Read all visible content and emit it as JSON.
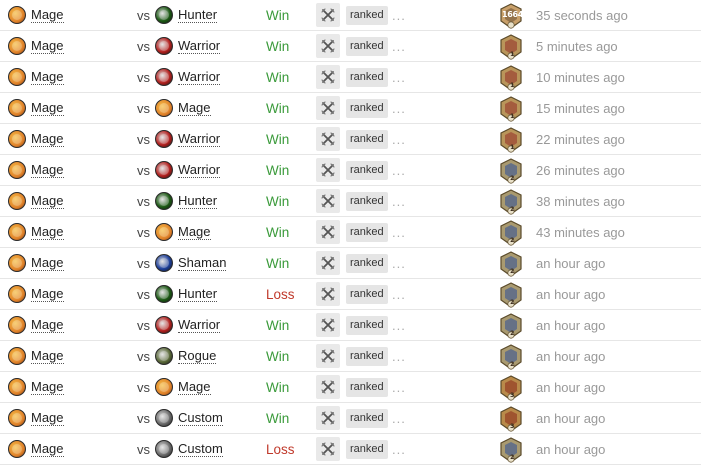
{
  "colors": {
    "win": "#3a9a3a",
    "loss": "#c0392b",
    "mage": "#e0822a",
    "hunter": "#1c5a14",
    "warrior": "#b3201e",
    "shaman": "#1d3f9a",
    "rogue": "#5b6a3a",
    "custom": "#6d6d6d"
  },
  "games": [
    {
      "hero": "Mage",
      "hero_icon": "mage-icon",
      "vs": "vs",
      "opponent": "Hunter",
      "opponent_icon": "hunter-icon",
      "result": "Win",
      "mode": "ranked",
      "dots": "...",
      "rank_icon": "legend-rank-icon",
      "rank": "1664",
      "time": "35 seconds ago"
    },
    {
      "hero": "Mage",
      "hero_icon": "mage-icon",
      "vs": "vs",
      "opponent": "Warrior",
      "opponent_icon": "warrior-icon",
      "result": "Win",
      "mode": "ranked",
      "dots": "...",
      "rank_icon": "rank-1-icon",
      "rank": "1",
      "time": "5 minutes ago"
    },
    {
      "hero": "Mage",
      "hero_icon": "mage-icon",
      "vs": "vs",
      "opponent": "Warrior",
      "opponent_icon": "warrior-icon",
      "result": "Win",
      "mode": "ranked",
      "dots": "...",
      "rank_icon": "rank-1-icon",
      "rank": "1",
      "time": "10 minutes ago"
    },
    {
      "hero": "Mage",
      "hero_icon": "mage-icon",
      "vs": "vs",
      "opponent": "Mage",
      "opponent_icon": "mage-icon",
      "result": "Win",
      "mode": "ranked",
      "dots": "...",
      "rank_icon": "rank-1-icon",
      "rank": "1",
      "time": "15 minutes ago"
    },
    {
      "hero": "Mage",
      "hero_icon": "mage-icon",
      "vs": "vs",
      "opponent": "Warrior",
      "opponent_icon": "warrior-icon",
      "result": "Win",
      "mode": "ranked",
      "dots": "...",
      "rank_icon": "rank-1-icon",
      "rank": "1",
      "time": "22 minutes ago"
    },
    {
      "hero": "Mage",
      "hero_icon": "mage-icon",
      "vs": "vs",
      "opponent": "Warrior",
      "opponent_icon": "warrior-icon",
      "result": "Win",
      "mode": "ranked",
      "dots": "...",
      "rank_icon": "rank-2-icon",
      "rank": "2",
      "time": "26 minutes ago"
    },
    {
      "hero": "Mage",
      "hero_icon": "mage-icon",
      "vs": "vs",
      "opponent": "Hunter",
      "opponent_icon": "hunter-icon",
      "result": "Win",
      "mode": "ranked",
      "dots": "...",
      "rank_icon": "rank-2-icon",
      "rank": "2",
      "time": "38 minutes ago"
    },
    {
      "hero": "Mage",
      "hero_icon": "mage-icon",
      "vs": "vs",
      "opponent": "Mage",
      "opponent_icon": "mage-icon",
      "result": "Win",
      "mode": "ranked",
      "dots": "...",
      "rank_icon": "rank-2-icon",
      "rank": "2",
      "time": "43 minutes ago"
    },
    {
      "hero": "Mage",
      "hero_icon": "mage-icon",
      "vs": "vs",
      "opponent": "Shaman",
      "opponent_icon": "shaman-icon",
      "result": "Win",
      "mode": "ranked",
      "dots": "...",
      "rank_icon": "rank-2-icon",
      "rank": "2",
      "time": "an hour ago"
    },
    {
      "hero": "Mage",
      "hero_icon": "mage-icon",
      "vs": "vs",
      "opponent": "Hunter",
      "opponent_icon": "hunter-icon",
      "result": "Loss",
      "mode": "ranked",
      "dots": "...",
      "rank_icon": "rank-2-icon",
      "rank": "2",
      "time": "an hour ago"
    },
    {
      "hero": "Mage",
      "hero_icon": "mage-icon",
      "vs": "vs",
      "opponent": "Warrior",
      "opponent_icon": "warrior-icon",
      "result": "Win",
      "mode": "ranked",
      "dots": "...",
      "rank_icon": "rank-2-icon",
      "rank": "2",
      "time": "an hour ago"
    },
    {
      "hero": "Mage",
      "hero_icon": "mage-icon",
      "vs": "vs",
      "opponent": "Rogue",
      "opponent_icon": "rogue-icon",
      "result": "Win",
      "mode": "ranked",
      "dots": "...",
      "rank_icon": "rank-2-icon",
      "rank": "2",
      "time": "an hour ago"
    },
    {
      "hero": "Mage",
      "hero_icon": "mage-icon",
      "vs": "vs",
      "opponent": "Mage",
      "opponent_icon": "mage-icon",
      "result": "Win",
      "mode": "ranked",
      "dots": "...",
      "rank_icon": "rank-3-icon",
      "rank": "3",
      "time": "an hour ago"
    },
    {
      "hero": "Mage",
      "hero_icon": "mage-icon",
      "vs": "vs",
      "opponent": "Custom",
      "opponent_icon": "custom-icon",
      "result": "Win",
      "mode": "ranked",
      "dots": "...",
      "rank_icon": "rank-3-icon",
      "rank": "3",
      "time": "an hour ago"
    },
    {
      "hero": "Mage",
      "hero_icon": "mage-icon",
      "vs": "vs",
      "opponent": "Custom",
      "opponent_icon": "custom-icon",
      "result": "Loss",
      "mode": "ranked",
      "dots": "...",
      "rank_icon": "rank-2-icon",
      "rank": "2",
      "time": "an hour ago"
    }
  ]
}
